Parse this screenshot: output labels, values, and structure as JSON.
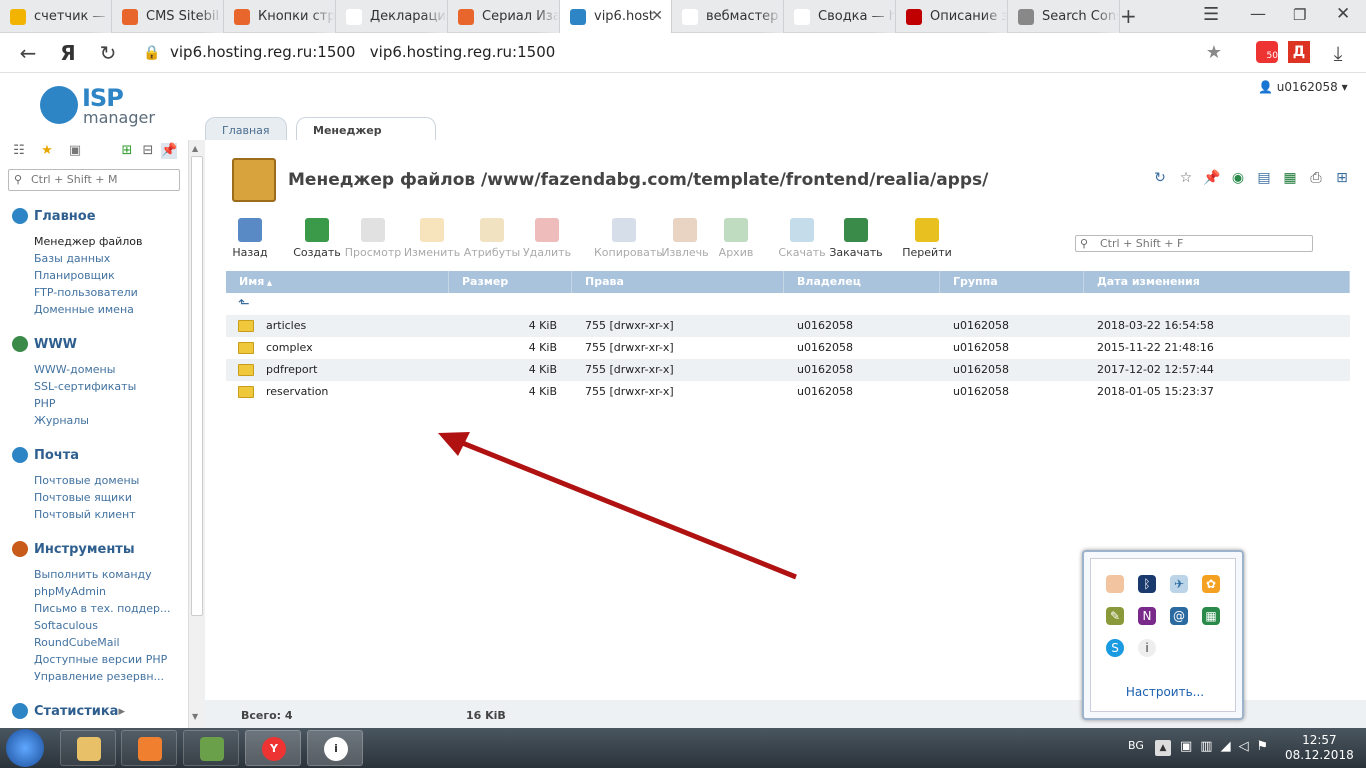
{
  "browser": {
    "tabs": [
      {
        "label": "счетчик — ",
        "color": "#f2b400"
      },
      {
        "label": "CMS Sitebil",
        "color": "#e8652b"
      },
      {
        "label": "Кнопки стр",
        "color": "#e8652b"
      },
      {
        "label": "Декларации",
        "color": "#ffffff"
      },
      {
        "label": "Сериал Иза",
        "color": "#e8652b"
      },
      {
        "label": "vip6.host",
        "color": "#2d85c6"
      },
      {
        "label": "вебмастер",
        "color": "#ffffff"
      },
      {
        "label": "Сводка — h",
        "color": "#ffffff"
      },
      {
        "label": "Описание з",
        "color": "#c00000"
      },
      {
        "label": "Search Cons",
        "color": "#888888"
      }
    ],
    "url": "vip6.hosting.reg.ru:1500",
    "url_title": "vip6.hosting.reg.ru:1500",
    "badge": "50"
  },
  "user": "u0162058",
  "logo": {
    "isp": "ISP",
    "manager": "manager"
  },
  "sidebar": {
    "search_placeholder": "Ctrl + Shift + M",
    "sections": [
      {
        "title": "Главное",
        "items": [
          "Менеджер файлов",
          "Базы данных",
          "Планировщик",
          "FTP-пользователи",
          "Доменные имена"
        ]
      },
      {
        "title": "WWW",
        "items": [
          "WWW-домены",
          "SSL-сертификаты",
          "PHP",
          "Журналы"
        ]
      },
      {
        "title": "Почта",
        "items": [
          "Почтовые домены",
          "Почтовые ящики",
          "Почтовый клиент"
        ]
      },
      {
        "title": "Инструменты",
        "items": [
          "Выполнить команду",
          "phpMyAdmin",
          "Письмо в тех. поддер...",
          "Softaculous",
          "RoundCubeMail",
          "Доступные версии PHP",
          "Управление резервн..."
        ]
      },
      {
        "title": "Статистика",
        "items": []
      }
    ]
  },
  "page_tabs": [
    "Главная",
    "Менеджер файлов"
  ],
  "title": "Менеджер файлов /www/fazendabg.com/template/frontend/realia/apps/",
  "toolbar": [
    "Назад",
    "Создать",
    "Просмотр",
    "Изменить",
    "Атрибуты",
    "Удалить",
    "Копировать",
    "Извлечь",
    "Архив",
    "Скачать",
    "Закачать",
    "Перейти"
  ],
  "file_search_placeholder": "Ctrl + Shift + F",
  "columns": [
    "Имя",
    "Размер",
    "Права",
    "Владелец",
    "Группа",
    "Дата изменения"
  ],
  "rows": [
    {
      "name": "articles",
      "size": "4 KiB",
      "perm": "755 [drwxr-xr-x]",
      "owner": "u0162058",
      "group": "u0162058",
      "date": "2018-03-22 16:54:58"
    },
    {
      "name": "complex",
      "size": "4 KiB",
      "perm": "755 [drwxr-xr-x]",
      "owner": "u0162058",
      "group": "u0162058",
      "date": "2015-11-22 21:48:16"
    },
    {
      "name": "pdfreport",
      "size": "4 KiB",
      "perm": "755 [drwxr-xr-x]",
      "owner": "u0162058",
      "group": "u0162058",
      "date": "2017-12-02 12:57:44"
    },
    {
      "name": "reservation",
      "size": "4 KiB",
      "perm": "755 [drwxr-xr-x]",
      "owner": "u0162058",
      "group": "u0162058",
      "date": "2018-01-05 15:23:37"
    }
  ],
  "footer": {
    "total": "Всего: 4",
    "size": "16 KiB"
  },
  "tray": {
    "link": "Настроить..."
  },
  "taskbar": {
    "lang": "BG",
    "time": "12:57",
    "date": "08.12.2018"
  }
}
